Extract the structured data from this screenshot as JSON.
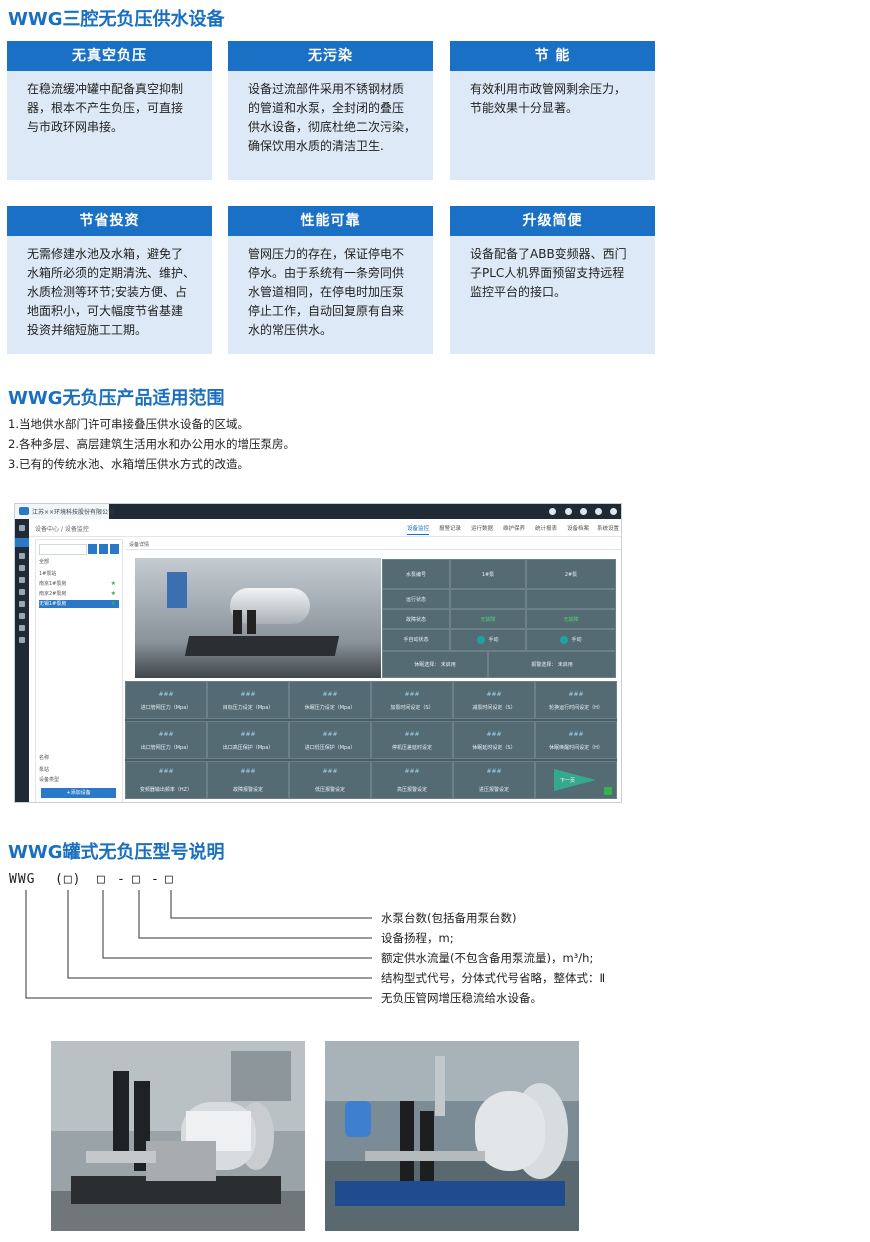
{
  "sections": {
    "s1_title": "WWG三腔无负压供水设备",
    "s2_title": "WWG无负压产品适用范围",
    "s3_title": "WWG罐式无负压型号说明"
  },
  "cards": [
    {
      "title": "无真空负压",
      "lines": [
        "在稳流缓冲罐中配备真空抑制",
        "器，根本不产生负压，可直接",
        "与市政环网串接。"
      ]
    },
    {
      "title": "无污染",
      "lines": [
        "设备过流部件采用不锈钢材质",
        "的管道和水泵，全封闭的叠压",
        "供水设备，彻底杜绝二次污染，",
        "确保饮用水质的清洁卫生."
      ]
    },
    {
      "title": "节 能",
      "lines": [
        "有效利用市政管网剩余压力，",
        "节能效果十分显著。"
      ]
    },
    {
      "title": "节省投资",
      "lines": [
        "无需修建水池及水箱，避免了",
        "水箱所必须的定期清洗、维护、",
        "水质检测等环节;安装方便、占",
        "地面积小，可大幅度节省基建",
        "投资并缩短施工工期。"
      ]
    },
    {
      "title": "性能可靠",
      "lines": [
        "管网压力的存在，保证停电不",
        "停水。由于系统有一条旁同供",
        "水管道相同，在停电时加压泵",
        "停止工作，自动回复原有自来",
        "水的常压供水。"
      ]
    },
    {
      "title": "升级简便",
      "lines": [
        "设备配备了ABB变频器、西门",
        "子PLC人机界面预留支持远程",
        "监控平台的接口。"
      ]
    }
  ],
  "scope": [
    "1.当地供水部门许可串接叠压供水设备的区域。",
    "2.各种多层、高层建筑生活用水和办公用水的增压泵房。",
    "3.已有的传统水池、水箱增压供水方式的改造。"
  ],
  "screenshot": {
    "company": "江苏××环境科技股份有限公司",
    "breadcrumb": "设备中心 / 设备监控",
    "tabs": [
      "设备监控",
      "报警记录",
      "运行数据",
      "维护保养",
      "统计报表",
      "设备档案",
      "系统设置"
    ],
    "tree_title": "全部",
    "tree_items": [
      "1#泵站",
      "南京1#泵房",
      "南京2#泵房",
      "无锡1#泵房"
    ],
    "tree_footer": [
      "名称",
      "泵站",
      "设备类型"
    ],
    "add_button": "+添加设备",
    "tab_label": "设备详情",
    "table_header": [
      "水泵编号",
      "1#泵",
      "2#泵"
    ],
    "table_rows": [
      {
        "label": "运行状态",
        "c1": "",
        "c2": ""
      },
      {
        "label": "故障状态",
        "c1": "无故障",
        "c2": "无故障"
      },
      {
        "label": "手自动状态",
        "c1": "手动",
        "c2": "手动"
      }
    ],
    "mode_left": "休眠选择：",
    "mode_left_val": "未启用",
    "mode_right": "报警选择：",
    "mode_right_val": "未启用",
    "value_placeholder": "###",
    "params": [
      "进口管网压力（Mpa）",
      "目标压力设定（Mpa）",
      "休眠压力设定（Mpa）",
      "加泵时间设定（S）",
      "减泵时间设定（S）",
      "轮换运行时间设定（H）",
      "出口管网压力（Mpa）",
      "出口高压保护（Mpa）",
      "进口低压保护（Mpa）",
      "停机压差延时设定",
      "休眠延时设定（S）",
      "休眠唤醒时间设定（H）",
      "变频器输出频率（HZ）",
      "故障报警设定",
      "低压报警设定",
      "高压报警设定",
      "进压报警设定"
    ],
    "next_button": "下一页"
  },
  "model": {
    "code": [
      "WWG",
      "(□)",
      "□",
      "-",
      "□",
      "-",
      "□"
    ],
    "legend": [
      "水泵台数(包括备用泵台数)",
      "设备扬程，m;",
      "额定供水流量(不包含备用泵流量)，m³/h;",
      "结构型式代号，分体式代号省略，整体式：Ⅱ",
      "无负压管网增压稳流给水设备。"
    ]
  }
}
